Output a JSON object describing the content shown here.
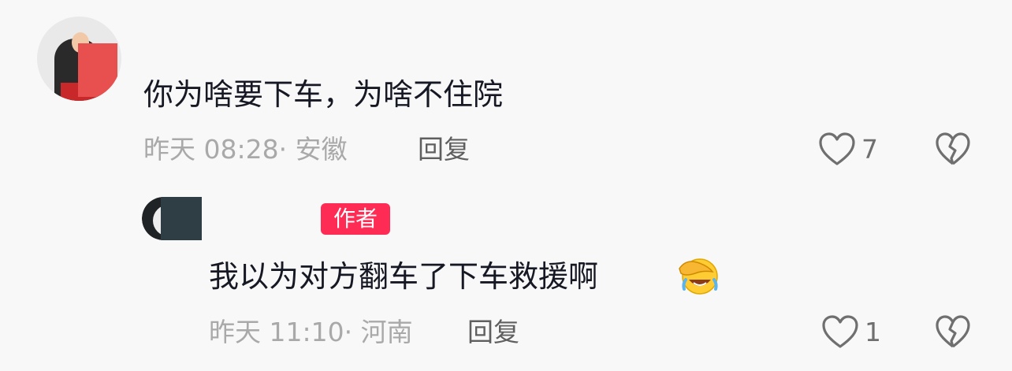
{
  "comment1": {
    "text": "你为啥要下车，为啥不住院",
    "meta": "昨天 08:28· 安徽",
    "reply_label": "回复",
    "like_count": "7"
  },
  "comment2": {
    "author_badge": "作者",
    "text": "我以为对方翻车了下车救援啊",
    "meta": "昨天 11:10· 河南",
    "reply_label": "回复",
    "like_count": "1"
  },
  "icons": {
    "like": "heart-outline-icon",
    "dislike": "broken-heart-icon",
    "emoji": "facepalm-laughing-emoji"
  },
  "colors": {
    "badge": "#fe2c55",
    "text": "#161823",
    "meta": "#a9a9a9"
  }
}
